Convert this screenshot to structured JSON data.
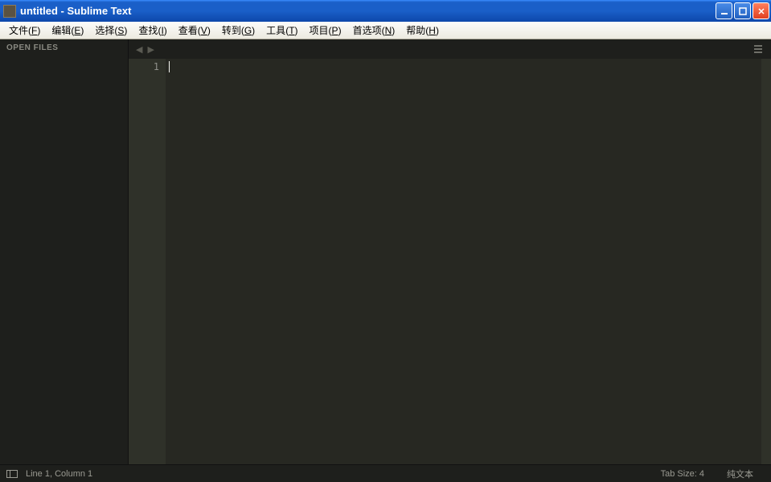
{
  "window": {
    "title": "untitled - Sublime Text"
  },
  "menu": {
    "items": [
      {
        "label": "文件",
        "hotkey": "F"
      },
      {
        "label": "编辑",
        "hotkey": "E"
      },
      {
        "label": "选择",
        "hotkey": "S"
      },
      {
        "label": "查找",
        "hotkey": "I"
      },
      {
        "label": "查看",
        "hotkey": "V"
      },
      {
        "label": "转到",
        "hotkey": "G"
      },
      {
        "label": "工具",
        "hotkey": "T"
      },
      {
        "label": "项目",
        "hotkey": "P"
      },
      {
        "label": "首选项",
        "hotkey": "N"
      },
      {
        "label": "帮助",
        "hotkey": "H"
      }
    ]
  },
  "sidebar": {
    "header": "OPEN FILES"
  },
  "editor": {
    "gutter": {
      "line1": "1"
    }
  },
  "statusbar": {
    "position": "Line 1, Column 1",
    "tabsize": "Tab Size: 4",
    "syntax": "纯文本"
  }
}
